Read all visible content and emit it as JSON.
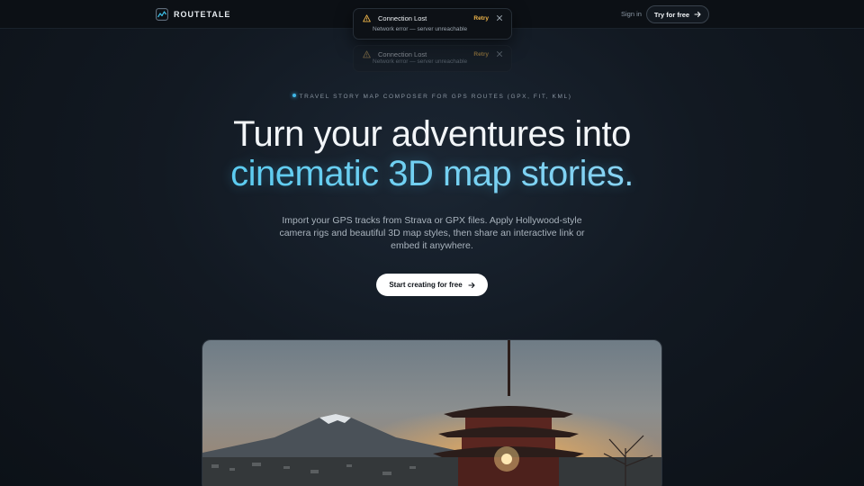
{
  "nav": {
    "brand": "ROUTETALE",
    "sign_in": "Sign in",
    "try_free": "Try for free"
  },
  "toasts": [
    {
      "title": "Connection Lost",
      "action": "Retry",
      "message": "Network error — server unreachable"
    },
    {
      "title": "Connection Lost",
      "action": "Retry",
      "message": "Network error — server unreachable"
    }
  ],
  "hero": {
    "eyebrow": "TRAVEL STORY MAP COMPOSER FOR GPS ROUTES (GPX, FIT, KML)",
    "headline_line1": "Turn your adventures into",
    "headline_line2": "cinematic 3D map stories.",
    "subtitle": "Import your GPS tracks from Strava or GPX files. Apply Hollywood-style camera rigs and beautiful 3D map styles, then share an interactive link or embed it anywhere.",
    "cta": "Start creating for free"
  },
  "colors": {
    "accent": "#3ec3ec",
    "warning": "#f0b64a",
    "background": "#121922"
  },
  "icons": [
    "logo-mark-icon",
    "warning-icon",
    "close-icon",
    "arrow-right-icon"
  ]
}
